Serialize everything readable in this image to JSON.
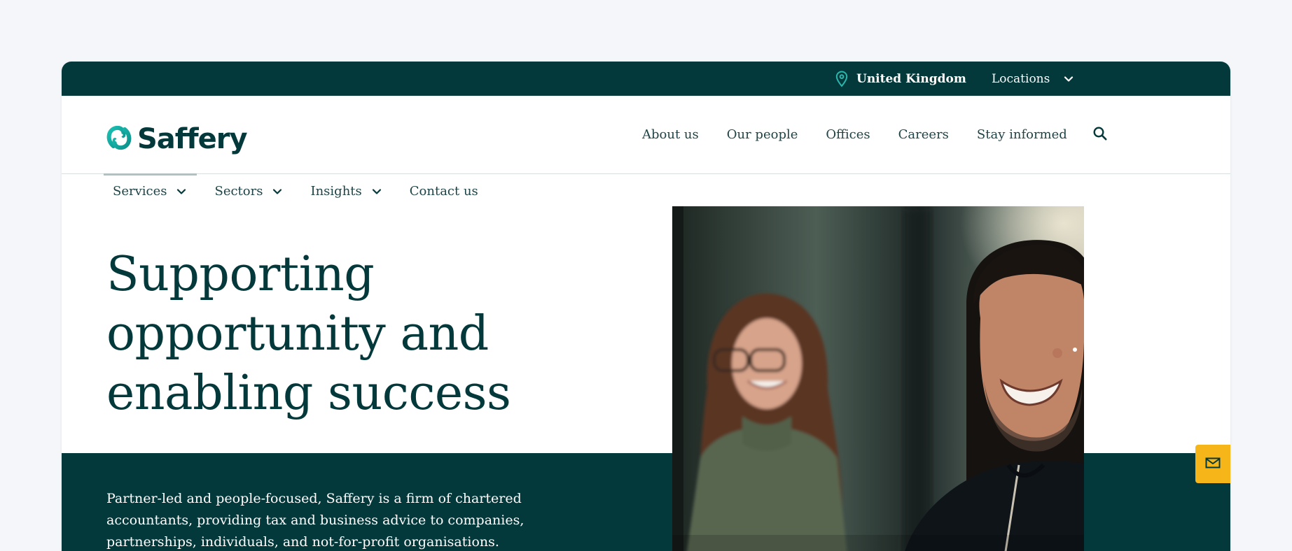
{
  "utility_bar": {
    "location_label": "United Kingdom",
    "locations_label": "Locations",
    "location_icon": "map-pin-icon",
    "chevron_icon": "chevron-down-icon"
  },
  "header": {
    "logo_text": "Saffery",
    "nav_items": [
      "About us",
      "Our people",
      "Offices",
      "Careers",
      "Stay informed"
    ],
    "search_icon": "search-icon"
  },
  "sub_nav": {
    "items": [
      {
        "label": "Services",
        "has_dropdown": true,
        "active": true
      },
      {
        "label": "Sectors",
        "has_dropdown": true,
        "active": false
      },
      {
        "label": "Insights",
        "has_dropdown": true,
        "active": false
      },
      {
        "label": "Contact us",
        "has_dropdown": false,
        "active": false
      }
    ]
  },
  "hero": {
    "title": "Supporting opportunity and enabling success",
    "intro": "Partner-led and people-focused, Saffery is a firm of chartered accountants, providing tax and business advice to companies, partnerships, individuals, and not-for-profit organisations."
  },
  "floating": {
    "contact_icon": "mail-icon"
  },
  "colors": {
    "brand_dark": "#04393c",
    "brand_teal": "#14b3a9",
    "accent_yellow": "#f6b619",
    "page_background": "#f5f6fa"
  }
}
